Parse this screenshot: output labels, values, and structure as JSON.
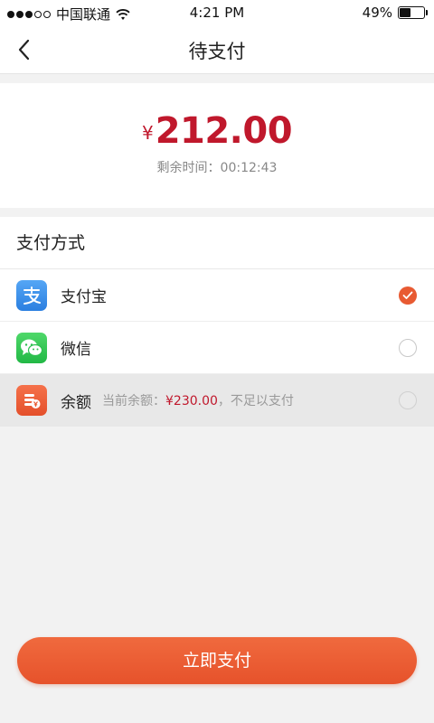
{
  "status_bar": {
    "carrier": "中国联通",
    "time": "4:21 PM",
    "battery": "49%",
    "battery_level": 0.49
  },
  "nav": {
    "title": "待支付",
    "back_icon": "chevron-left-icon"
  },
  "payment": {
    "currency_symbol": "¥",
    "amount": "212.00",
    "countdown_label": "剩余时间：",
    "countdown_value": "00:12:43"
  },
  "methods": {
    "title": "支付方式",
    "items": [
      {
        "label": "支付宝",
        "icon": "alipay-icon",
        "selected": true
      },
      {
        "label": "微信",
        "icon": "wechat-icon",
        "selected": false
      },
      {
        "label": "余额",
        "icon": "balance-icon",
        "selected": false,
        "disabled": true,
        "note_prefix": "当前余额：",
        "note_amount": "¥230.00",
        "note_suffix": "，不足以支付"
      }
    ]
  },
  "colors": {
    "accent": "#e85a32",
    "price": "#c0182c"
  },
  "actions": {
    "pay_label": "立即支付"
  }
}
